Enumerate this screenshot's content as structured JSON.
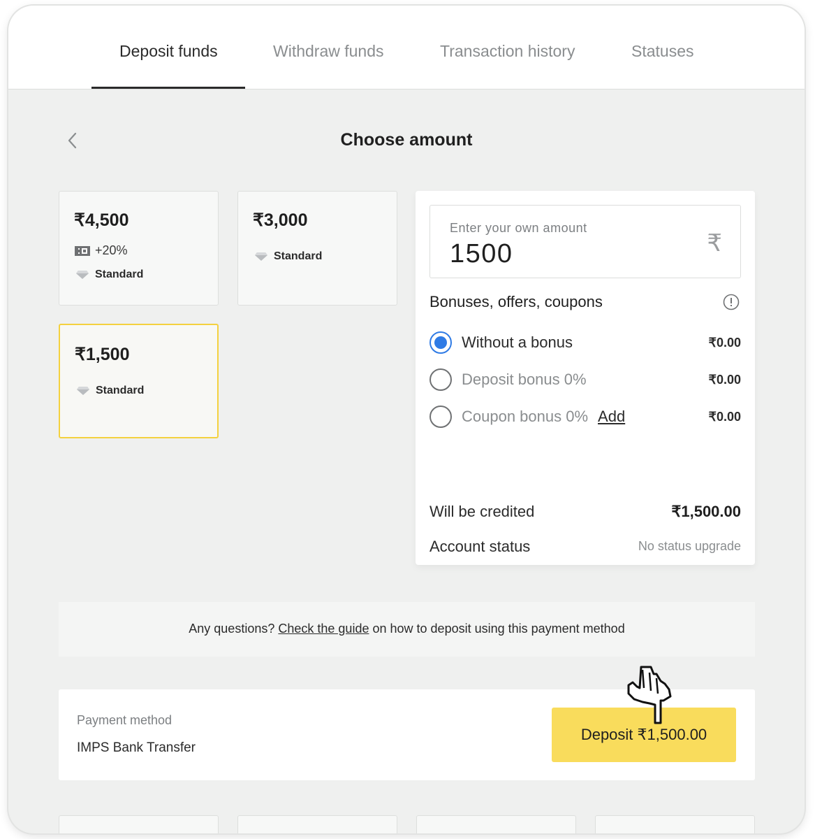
{
  "tabs": [
    {
      "label": "Deposit funds",
      "active": true
    },
    {
      "label": "Withdraw funds",
      "active": false
    },
    {
      "label": "Transaction history",
      "active": false
    },
    {
      "label": "Statuses",
      "active": false
    }
  ],
  "page": {
    "title": "Choose amount"
  },
  "cards": [
    {
      "amount": "₹4,500",
      "bonus": "+20%",
      "status": "Standard",
      "selected": false
    },
    {
      "amount": "₹3,000",
      "status": "Standard",
      "selected": false
    },
    {
      "amount": "₹1,500",
      "status": "Standard",
      "selected": true
    }
  ],
  "amount_input": {
    "label": "Enter your own amount",
    "value": "1500",
    "currency_icon": "₹"
  },
  "bonuses": {
    "title": "Bonuses, offers, coupons",
    "options": [
      {
        "label": "Without a bonus",
        "value": "₹0.00",
        "selected": true
      },
      {
        "label": "Deposit bonus 0%",
        "value": "₹0.00",
        "selected": false
      },
      {
        "label": "Coupon bonus 0%",
        "link": "Add",
        "value": "₹0.00",
        "selected": false
      }
    ]
  },
  "summary": {
    "credited_label": "Will be credited",
    "credited_value": "₹1,500.00",
    "status_label": "Account status",
    "status_value": "No status upgrade"
  },
  "guide": {
    "prefix": "Any questions?",
    "link": "Check the guide",
    "suffix": "on how to deposit using this payment method"
  },
  "payment": {
    "label": "Payment method",
    "value": "IMPS Bank Transfer",
    "button": "Deposit ₹1,500.00"
  },
  "colors": {
    "accent_yellow": "#f9dc5c",
    "selected_border": "#f4d13f",
    "radio_blue": "#2f7be5"
  }
}
